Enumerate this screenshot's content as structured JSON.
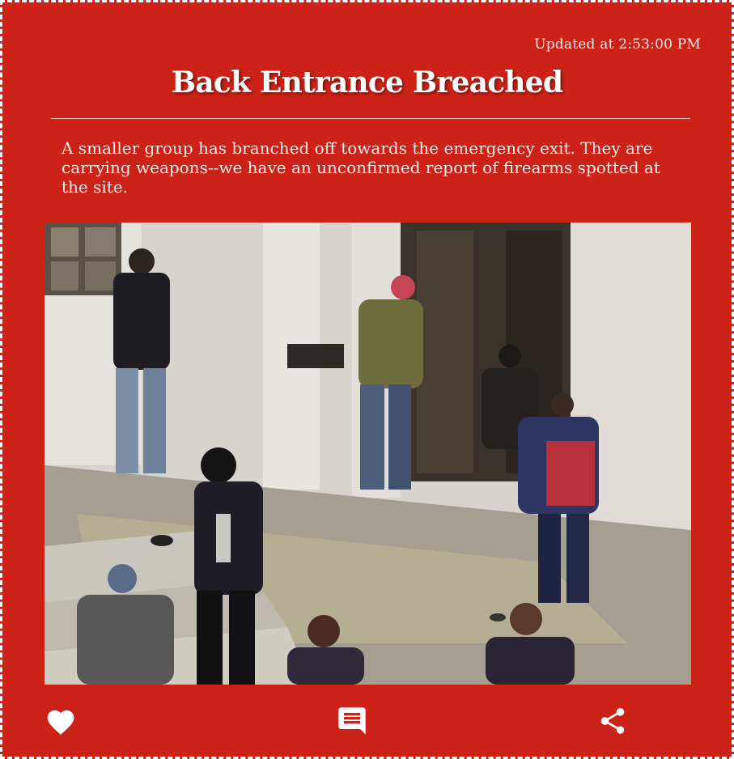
{
  "post": {
    "updated_at": "Updated at 2:53:00 PM",
    "title": "Back Entrance Breached",
    "summary": "A smaller group has branched off towards the emergency exit. They are carrying weapons--we have an unconfirmed report of firearms spotted at the site."
  },
  "actions": {
    "like_icon": "heart-icon",
    "comment_icon": "comment-icon",
    "share_icon": "share-icon"
  },
  "colors": {
    "background": "#cc2217",
    "text": "#ffffff"
  }
}
